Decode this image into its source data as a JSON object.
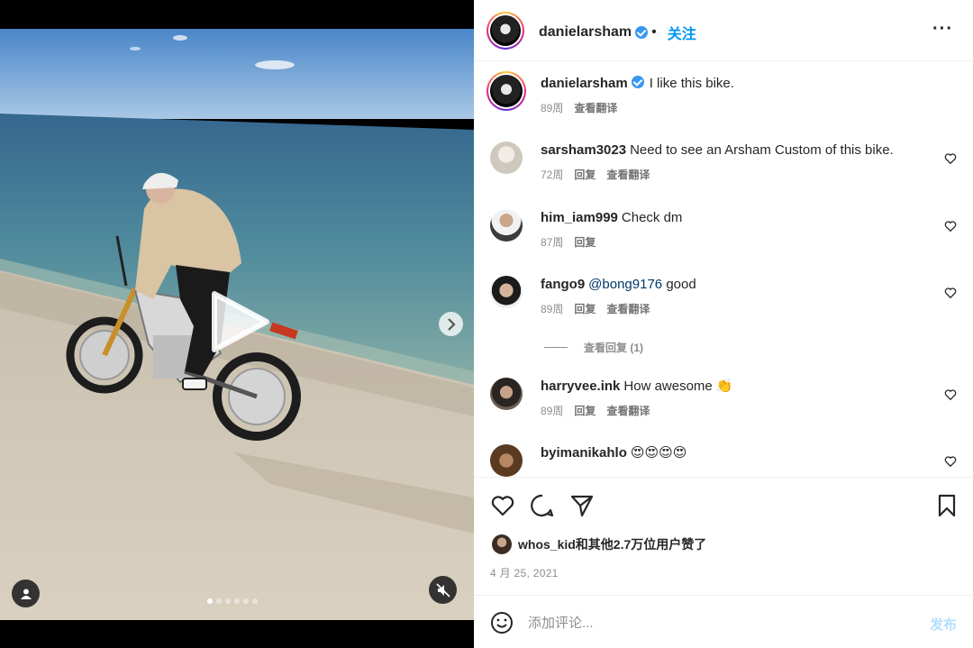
{
  "post": {
    "author": "danielarsham",
    "follow_label": "关注",
    "more_label": "···"
  },
  "caption": {
    "username": "danielarsham",
    "text": "I like this bike.",
    "time": "89周",
    "translate": "查看翻译"
  },
  "comments": [
    {
      "username": "sarsham3023",
      "text": "Need to see an Arsham Custom of this bike.",
      "time": "72周",
      "reply": "回复",
      "translate": "查看翻译"
    },
    {
      "username": "him_iam999",
      "text": "Check dm",
      "time": "87周",
      "reply": "回复",
      "translate": ""
    },
    {
      "username": "fango9",
      "mention": "@bong9176",
      "text": "good",
      "time": "89周",
      "reply": "回复",
      "translate": "查看翻译"
    },
    {
      "username": "harryvee.ink",
      "text": "How awesome 👏",
      "time": "89周",
      "reply": "回复",
      "translate": "查看翻译"
    },
    {
      "username": "byimanikahlo",
      "text": "😍😍😍😍",
      "time": "",
      "reply": "",
      "translate": ""
    }
  ],
  "view_replies": "查看回复 (1)",
  "likes": {
    "user": "whos_kid",
    "text": "和其他2.7万位用户赞了"
  },
  "date": "4 月 25, 2021",
  "composer": {
    "placeholder": "添加评论...",
    "post_label": "发布"
  },
  "carousel": {
    "count": 6,
    "active_index": 0
  },
  "colors": {
    "accent": "#0095f6",
    "verified": "#3897f0",
    "post_disabled": "#b2dffc",
    "meta_gray": "#8e8e8e"
  },
  "icons": [
    "play-icon",
    "chevron-right-icon",
    "user-tag-icon",
    "mute-icon",
    "verified-icon",
    "more-icon",
    "heart-icon",
    "comment-icon",
    "share-icon",
    "bookmark-icon",
    "emoji-icon"
  ]
}
